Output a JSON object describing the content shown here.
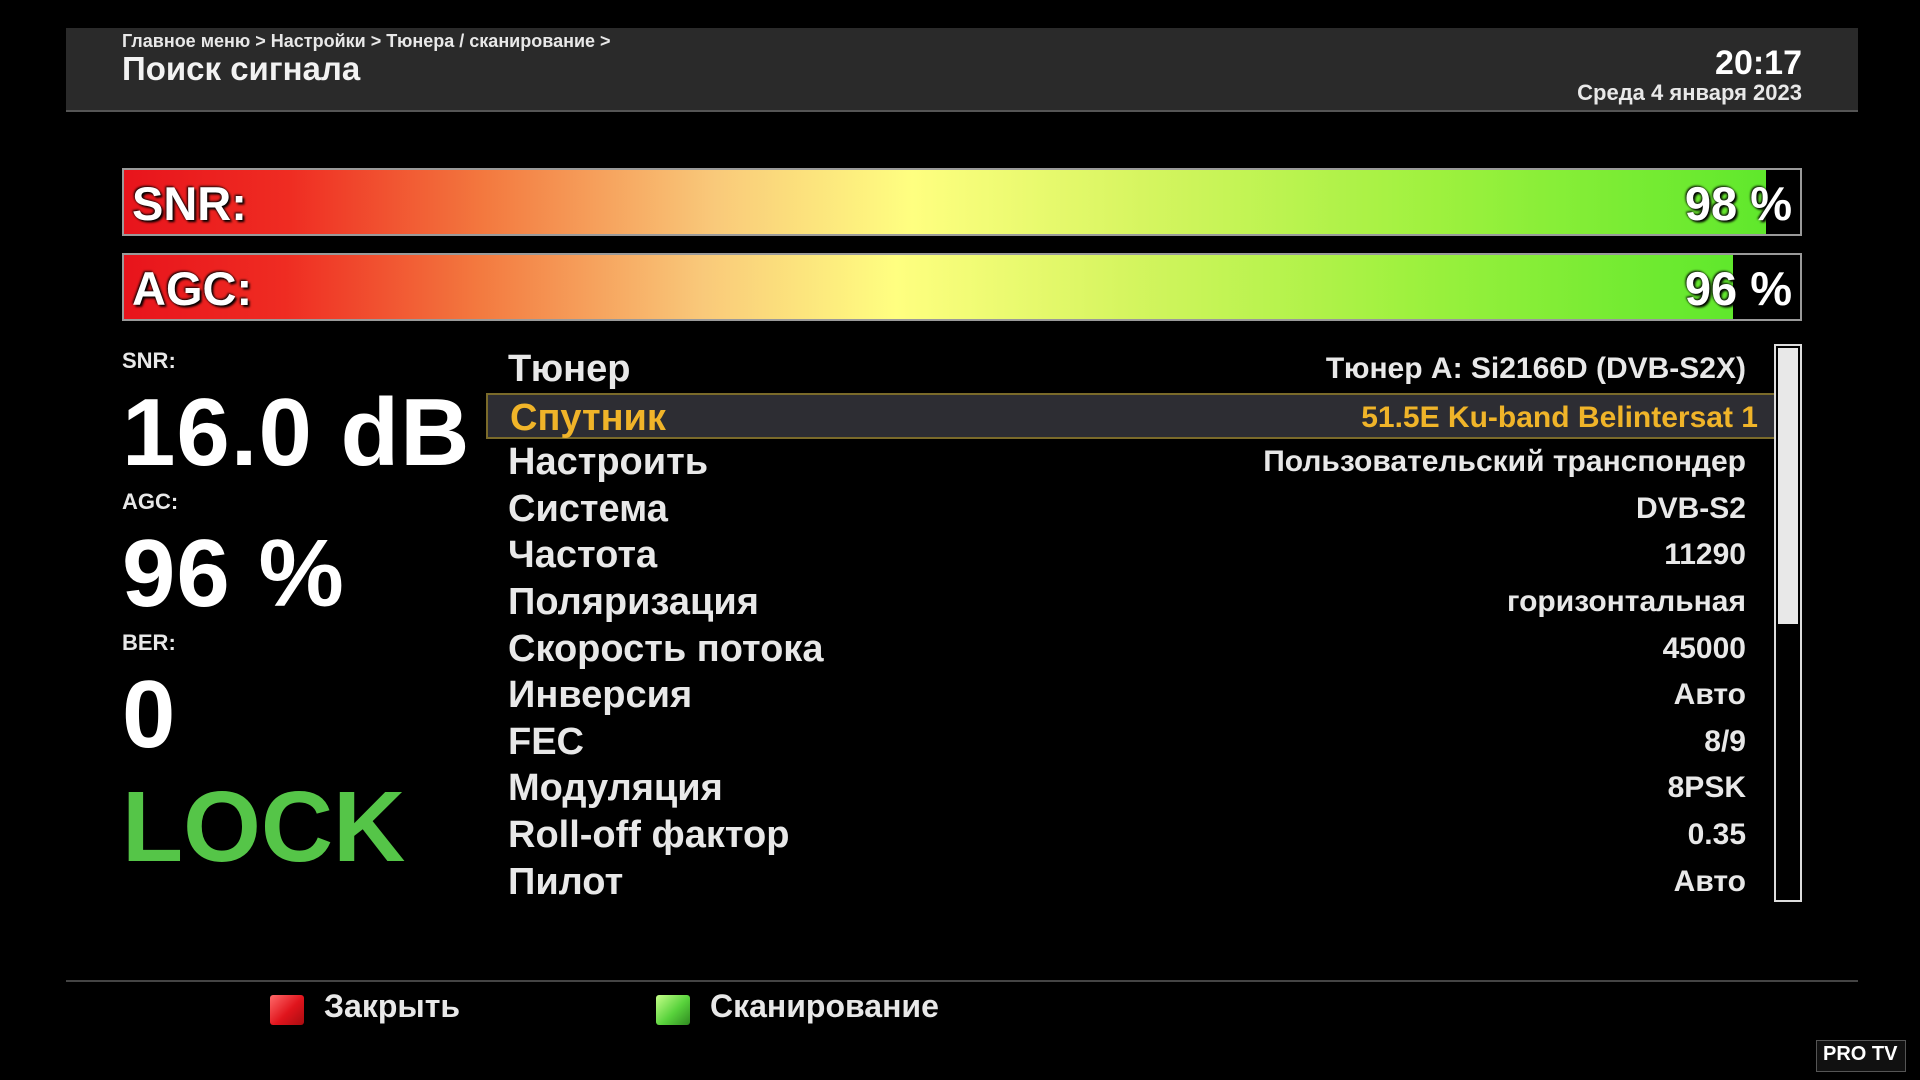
{
  "header": {
    "breadcrumb": "Главное меню > Настройки > Тюнера / сканирование >",
    "title": "Поиск сигнала",
    "time": "20:17",
    "date": "Среда  4 января 2023"
  },
  "meters": {
    "snr": {
      "label": "SNR:",
      "value_text": "98 %",
      "level_percent": 98
    },
    "agc": {
      "label": "AGC:",
      "value_text": "96 %",
      "level_percent": 96
    }
  },
  "stats": {
    "snr_label": "SNR:",
    "snr_value": "16.0 dB",
    "agc_label": "AGC:",
    "agc_value": "96 %",
    "ber_label": "BER:",
    "ber_value": "0",
    "lock_status": "LOCK"
  },
  "settings": [
    {
      "label": "Тюнер",
      "value": "Тюнер A: Si2166D (DVB-S2X)",
      "selected": false
    },
    {
      "label": "Спутник",
      "value": "51.5E Ku-band Belintersat 1",
      "selected": true
    },
    {
      "label": "Настроить",
      "value": "Пользовательский транспондер",
      "selected": false
    },
    {
      "label": "Система",
      "value": "DVB-S2",
      "selected": false
    },
    {
      "label": "Частота",
      "value": "11290",
      "selected": false
    },
    {
      "label": "Поляризация",
      "value": "горизонтальная",
      "selected": false
    },
    {
      "label": "Скорость потока",
      "value": "45000",
      "selected": false
    },
    {
      "label": "Инверсия",
      "value": "Авто",
      "selected": false
    },
    {
      "label": "FEC",
      "value": "8/9",
      "selected": false
    },
    {
      "label": "Модуляция",
      "value": "8PSK",
      "selected": false
    },
    {
      "label": "Roll-off фактор",
      "value": "0.35",
      "selected": false
    },
    {
      "label": "Пилот",
      "value": "Авто",
      "selected": false
    }
  ],
  "footer": {
    "red_key_label": "Закрыть",
    "green_key_label": "Сканирование"
  },
  "watermark": {
    "text": "PRO TV"
  },
  "colors": {
    "selected_text": "#f0b429",
    "lock_color": "#55c548",
    "red_key": "#e0141c",
    "green_key": "#58d23c"
  }
}
